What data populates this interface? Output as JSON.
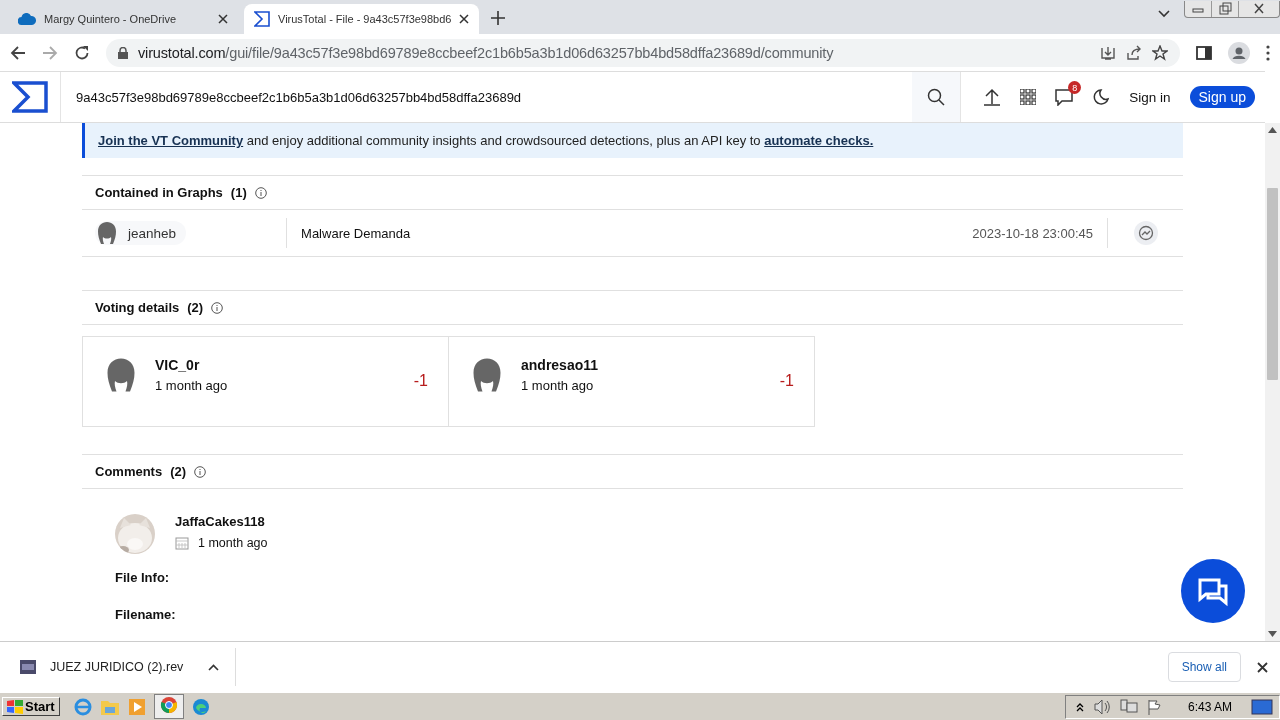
{
  "browser": {
    "tabs": [
      {
        "title": "Margy Quintero - OneDrive",
        "selected": false
      },
      {
        "title": "VirusTotal - File - 9a43c57f3e98bd6",
        "selected": true
      }
    ],
    "url_host": "virustotal.com",
    "url_path": "/gui/file/9a43c57f3e98bd69789e8ccbeef2c1b6b5a3b1d06d63257bb4bd58dffa23689d/community"
  },
  "header": {
    "search_value": "9a43c57f3e98bd69789e8ccbeef2c1b6b5a3b1d06d63257bb4bd58dffa23689d",
    "notification_count": "8",
    "sign_in": "Sign in",
    "sign_up": "Sign up"
  },
  "banner": {
    "link_1": "Join the VT Community",
    "text": "and enjoy additional community insights and crowdsourced detections, plus an API key to",
    "link_2": "automate checks."
  },
  "graphs": {
    "title": "Contained in Graphs",
    "count": "(1)",
    "rows": [
      {
        "user": "jeanheb",
        "name": "Malware Demanda",
        "date": "2023-10-18 23:00:45"
      }
    ]
  },
  "votes": {
    "title": "Voting details",
    "count": "(2)",
    "items": [
      {
        "user": "VIC_0r",
        "time": "1 month ago",
        "verdict": "-1"
      },
      {
        "user": "andresao11",
        "time": "1 month ago",
        "verdict": "-1"
      }
    ]
  },
  "comments": {
    "title": "Comments",
    "count": "(2)",
    "items": [
      {
        "user": "JaffaCakes118",
        "time": "1 month ago",
        "lines": [
          "File Info:",
          "Filename:"
        ]
      }
    ]
  },
  "download_bar": {
    "file": "JUEZ JURIDICO (2).rev",
    "show_all": "Show all"
  },
  "taskbar": {
    "start": "Start",
    "clock": "6:43 AM"
  }
}
